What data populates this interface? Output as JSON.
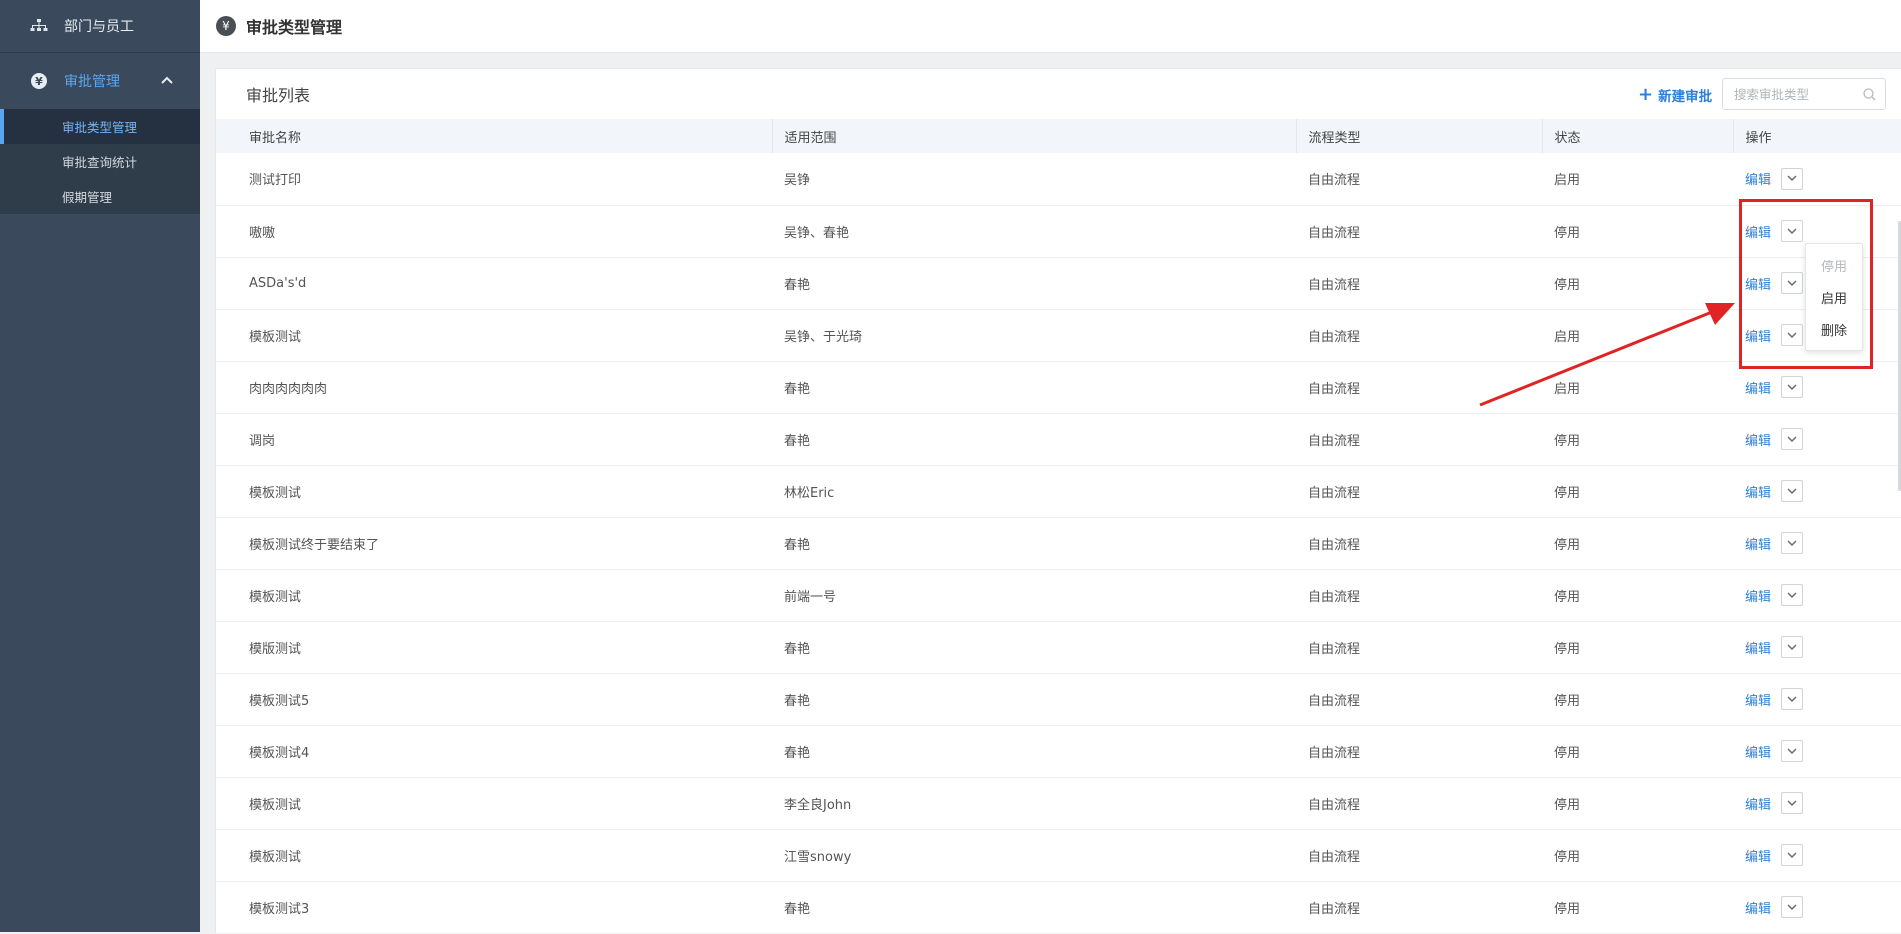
{
  "sidebar": {
    "top_item": {
      "label": "部门与员工",
      "icon": "org-chart-icon"
    },
    "group": {
      "label": "审批管理",
      "icon": "yen-circle-icon",
      "expanded": true
    },
    "sub_items": [
      {
        "label": "审批类型管理",
        "active": true
      },
      {
        "label": "审批查询统计",
        "active": false
      },
      {
        "label": "假期管理",
        "active": false
      }
    ]
  },
  "header": {
    "title": "审批类型管理",
    "icon_glyph": "¥"
  },
  "panel": {
    "title": "审批列表",
    "new_button": "新建审批",
    "search_placeholder": "搜索审批类型",
    "columns": [
      "审批名称",
      "适用范围",
      "流程类型",
      "状态",
      "操作"
    ],
    "rows": [
      {
        "name": "测试打印",
        "scope": "吴铮",
        "flow": "自由流程",
        "status": "启用",
        "edit": "编辑"
      },
      {
        "name": "嗷嗷",
        "scope": "吴铮、春艳",
        "flow": "自由流程",
        "status": "停用",
        "edit": "编辑"
      },
      {
        "name": "ASDa's'd",
        "scope": "春艳",
        "flow": "自由流程",
        "status": "停用",
        "edit": "编辑"
      },
      {
        "name": "模板测试",
        "scope": "吴铮、于光琦",
        "flow": "自由流程",
        "status": "启用",
        "edit": "编辑"
      },
      {
        "name": "肉肉肉肉肉肉",
        "scope": "春艳",
        "flow": "自由流程",
        "status": "启用",
        "edit": "编辑"
      },
      {
        "name": "调岗",
        "scope": "春艳",
        "flow": "自由流程",
        "status": "停用",
        "edit": "编辑"
      },
      {
        "name": "模板测试",
        "scope": "林松Eric",
        "flow": "自由流程",
        "status": "停用",
        "edit": "编辑"
      },
      {
        "name": "模板测试终于要结束了",
        "scope": "春艳",
        "flow": "自由流程",
        "status": "停用",
        "edit": "编辑"
      },
      {
        "name": "模板测试",
        "scope": "前端一号",
        "flow": "自由流程",
        "status": "停用",
        "edit": "编辑"
      },
      {
        "name": "模版测试",
        "scope": "春艳",
        "flow": "自由流程",
        "status": "停用",
        "edit": "编辑"
      },
      {
        "name": "模板测试5",
        "scope": "春艳",
        "flow": "自由流程",
        "status": "停用",
        "edit": "编辑"
      },
      {
        "name": "模板测试4",
        "scope": "春艳",
        "flow": "自由流程",
        "status": "停用",
        "edit": "编辑"
      },
      {
        "name": "模板测试",
        "scope": "李全良John",
        "flow": "自由流程",
        "status": "停用",
        "edit": "编辑"
      },
      {
        "name": "模板测试",
        "scope": "江雪snowy",
        "flow": "自由流程",
        "status": "停用",
        "edit": "编辑"
      },
      {
        "name": "模板测试3",
        "scope": "春艳",
        "flow": "自由流程",
        "status": "停用",
        "edit": "编辑"
      }
    ]
  },
  "dropdown_menu": {
    "items": [
      {
        "label": "停用",
        "disabled": true
      },
      {
        "label": "启用",
        "disabled": false
      },
      {
        "label": "删除",
        "disabled": false
      }
    ]
  },
  "annotation": {
    "highlight_color": "#e02424"
  },
  "colors": {
    "sidebar_bg": "#3a4a5c",
    "accent": "#2f80d8",
    "active_text": "#5aa6f4"
  }
}
